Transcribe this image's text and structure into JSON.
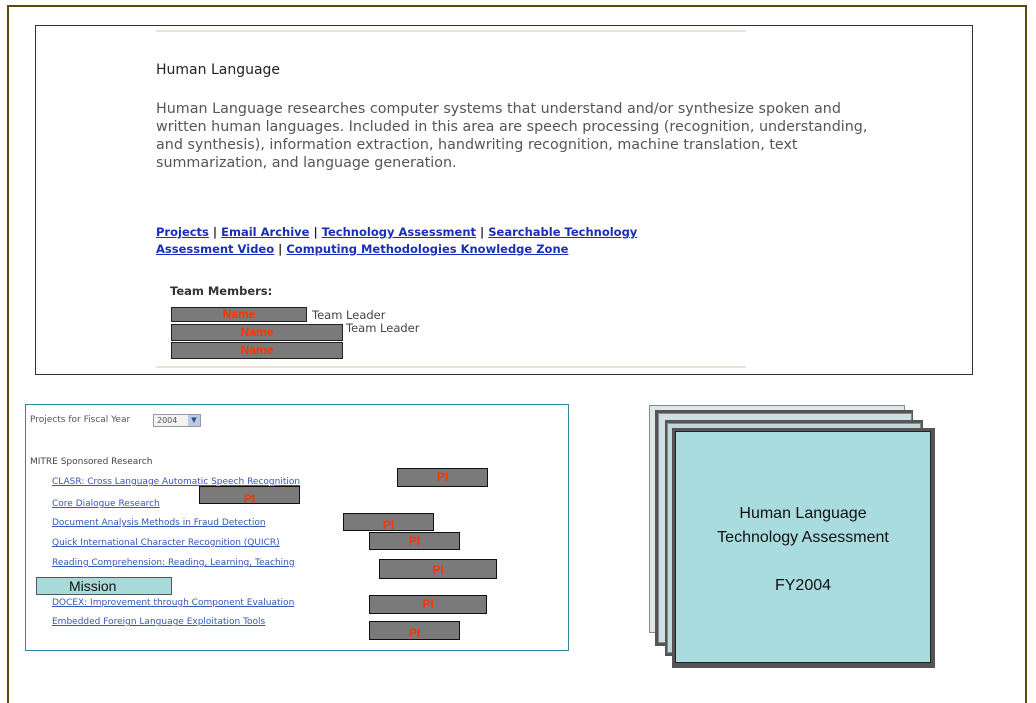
{
  "top_panel": {
    "heading": "Human Language",
    "description": "Human Language researches computer systems that understand and/or synthesize spoken and written human languages. Included in this area are speech processing (recognition, understanding, and synthesis), information extraction, handwriting recognition, machine translation, text summarization, and language generation.",
    "links": {
      "projects": "Projects",
      "email_archive": "Email Archive",
      "tech_assessment": "Technology Assessment",
      "searchable_line1": "Searchable Technology",
      "searchable_line2": "Assessment Video",
      "knowledge_zone": "Computing Methodologies Knowledge Zone",
      "separator": "|"
    },
    "team_title": "Team Members:",
    "members": [
      {
        "name": "Name",
        "role": "Team Leader"
      },
      {
        "name": "Name",
        "role": "Team Leader"
      },
      {
        "name": "Name",
        "role": ""
      }
    ]
  },
  "projects_panel": {
    "fy_label": "Projects for Fiscal Year",
    "fy_value": "2004",
    "sponsor_heading": "MITRE Sponsored Research",
    "items": [
      "CLASR: Cross Language Automatic Speech Recognition",
      "Core Dialogue Research",
      "Document Analysis Methods in Fraud Detection",
      "Quick International Character Recognition (QUICR)",
      "Reading Comprehension: Reading, Learning, Teaching",
      "DOCEX: Improvement through Component Evaluation",
      "Embedded Foreign Language Exploitation Tools"
    ],
    "pi_label": "PI",
    "mission_label": "Mission"
  },
  "card": {
    "line1": "Human Language",
    "line2": "Technology Assessment",
    "line3": "FY2004"
  }
}
